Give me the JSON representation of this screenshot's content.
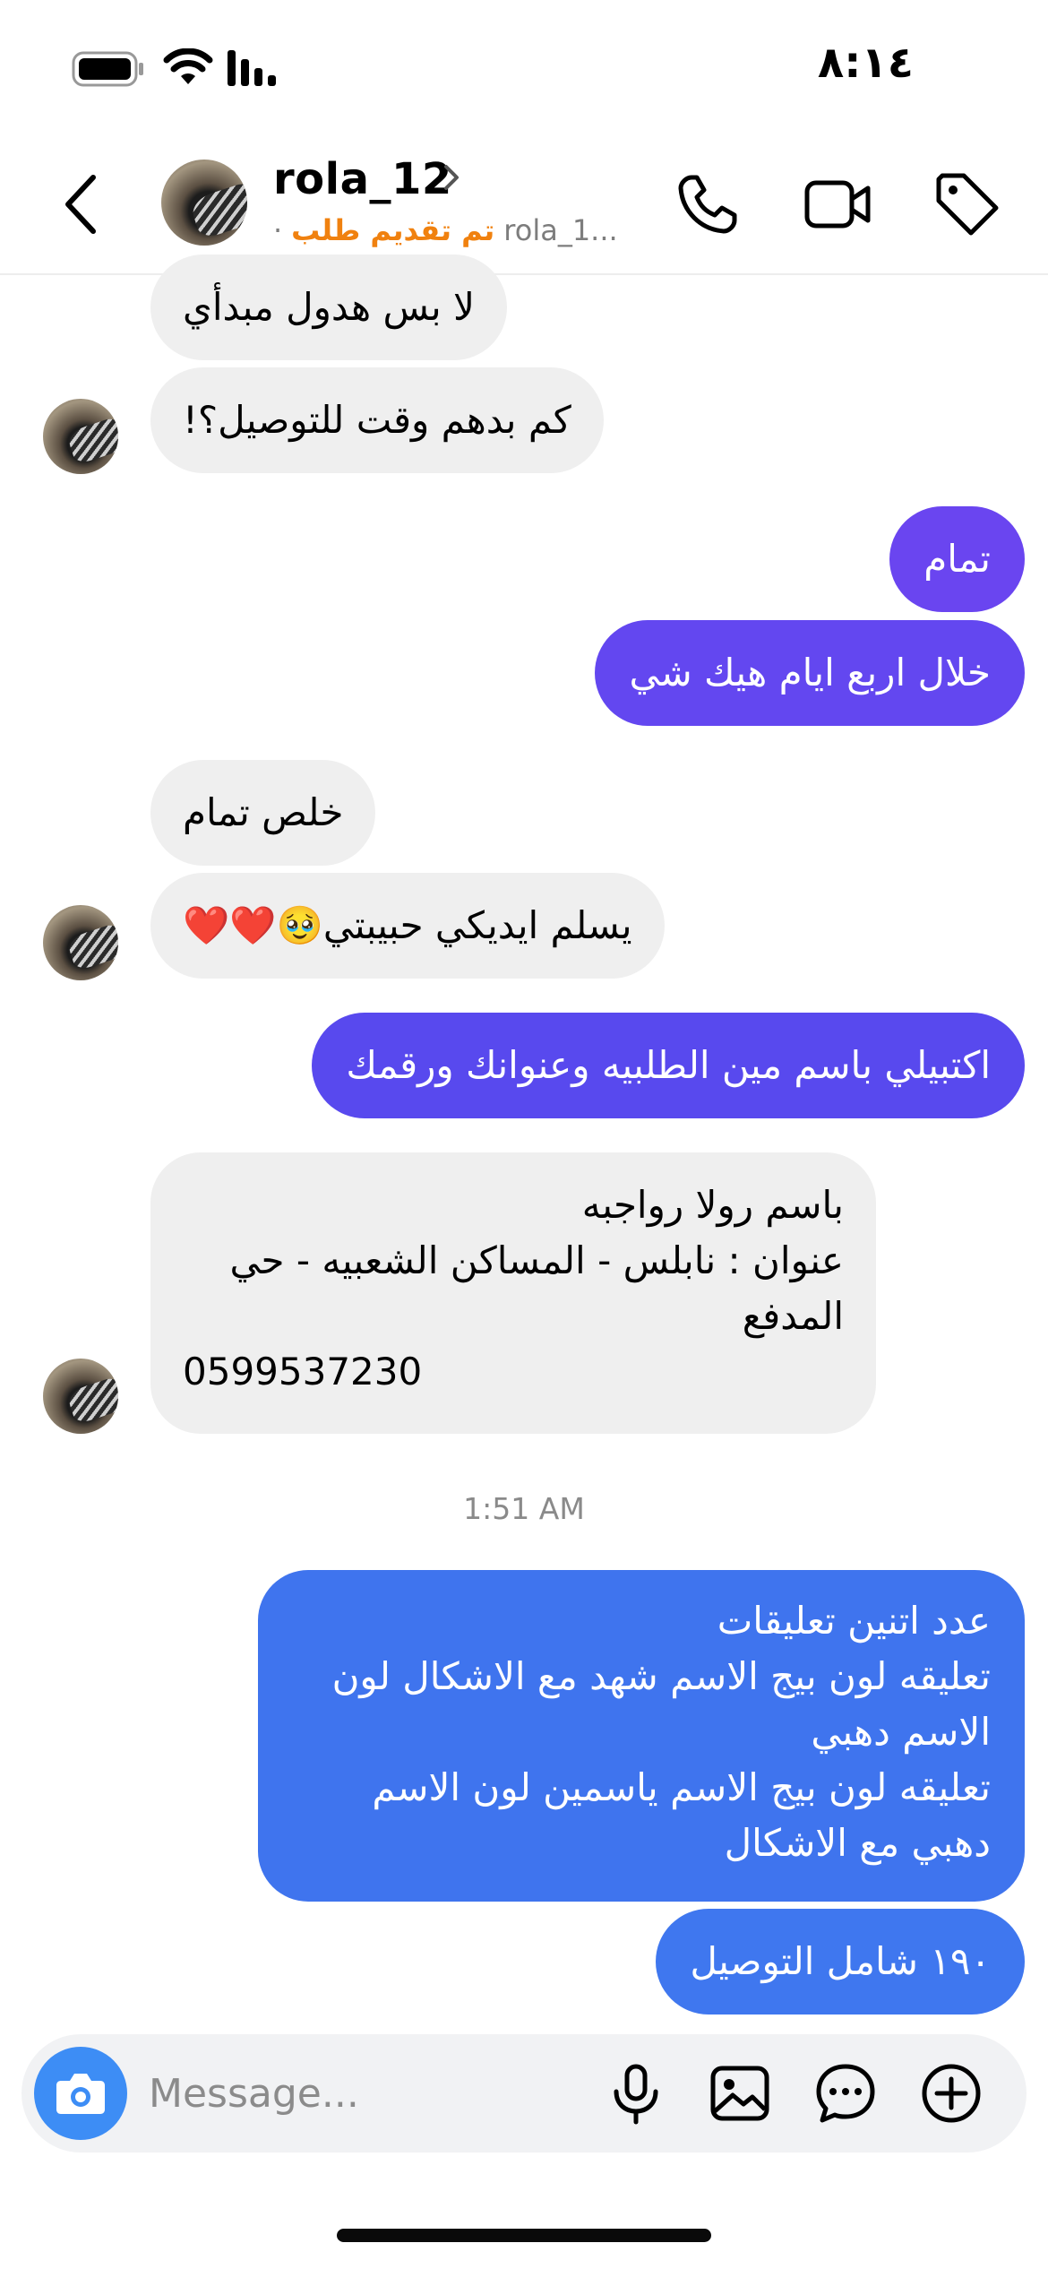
{
  "status_bar": {
    "time": "٨:١٤",
    "icons": [
      "battery-icon",
      "wifi-icon",
      "signal-icon"
    ]
  },
  "header": {
    "username": "rola_12",
    "sub_username": "rola_1...",
    "sub_status": "تم تقديم طلب",
    "separator": "·",
    "actions": [
      "phone-icon",
      "video-icon",
      "tag-icon"
    ]
  },
  "messages": [
    {
      "side": "in",
      "text": "لا بس هدول مبدأي"
    },
    {
      "side": "in",
      "text": "كم بدهم وقت للتوصيل؟!"
    },
    {
      "side": "out",
      "text": "تمام"
    },
    {
      "side": "out",
      "text": "خلال اربع ايام هيك شي"
    },
    {
      "side": "in",
      "text": "خلص تمام"
    },
    {
      "side": "in",
      "text": "يسلم ايديكي حبيبتي🥹❤️❤️"
    },
    {
      "side": "out",
      "text": "اكتبيلي باسم مين الطلبيه وعنوانك ورقمك"
    },
    {
      "side": "in",
      "lines": [
        "باسم رولا رواجبه",
        "عنوان : نابلس - المساكن الشعبيه - حي",
        "المدفع",
        "0599537230"
      ]
    },
    {
      "side": "out",
      "lines": [
        "عدد اتنين تعليقات",
        "تعليقه لون بيج الاسم شهد مع الاشكال لون",
        "الاسم دهبي",
        "تعليقه لون بيج الاسم ياسمين  لون الاسم",
        "دهبي مع الاشكال"
      ]
    },
    {
      "side": "out",
      "text": "١٩٠ شامل التوصيل"
    }
  ],
  "timestamp": "1:51 AM",
  "composer": {
    "placeholder": "Message...",
    "icons": [
      "camera-icon",
      "microphone-icon",
      "image-icon",
      "sticker-chat-icon",
      "plus-icon"
    ]
  },
  "colors": {
    "incoming_bubble": "#efefef",
    "outgoing_purple": "#6a45f0",
    "outgoing_indigo": "#5849ee",
    "outgoing_blue": "#3e73ee",
    "status_orange": "#f0810f",
    "camera_blue": "#3d8df5"
  }
}
